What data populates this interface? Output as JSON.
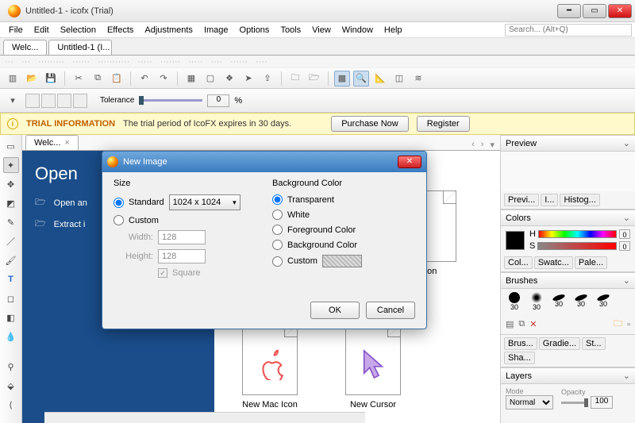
{
  "titlebar": {
    "title": "Untitled-1 - icofx (Trial)"
  },
  "menu": [
    "File",
    "Edit",
    "Selection",
    "Effects",
    "Adjustments",
    "Image",
    "Options",
    "Tools",
    "View",
    "Window",
    "Help"
  ],
  "search_placeholder": "Search... (Alt+Q)",
  "doctabs": [
    "Welc...",
    "Untitled-1 (I..."
  ],
  "tolerance": {
    "label": "Tolerance",
    "value": "0",
    "unit": "%"
  },
  "trial": {
    "title": "TRIAL INFORMATION",
    "text": "The trial period of IcoFX expires in 30 days.",
    "purchase": "Purchase Now",
    "register": "Register"
  },
  "canvas_tab": "Welc...",
  "bluepane": {
    "heading": "Open",
    "row1": "Open an",
    "row2": "Extract i"
  },
  "whitepane": {
    "item_icon": "Icon",
    "item_mac": "New Mac Icon",
    "item_cursor": "New Cursor"
  },
  "right": {
    "preview": "Preview",
    "preview_tabs": [
      "Previ...",
      "I...",
      "Histog..."
    ],
    "colors": "Colors",
    "h_label": "H",
    "s_label": "S",
    "h_val": "0",
    "s_val": "0",
    "colors_tabs": [
      "Col...",
      "Swatc...",
      "Pale..."
    ],
    "brushes": "Brushes",
    "brush_size": "30",
    "brushes_tabs": [
      "Brus...",
      "Gradie...",
      "St...",
      "Sha..."
    ],
    "layers": "Layers",
    "mode_label": "Mode",
    "opacity_label": "Opacity",
    "mode_value": "Normal",
    "opacity_value": "100"
  },
  "dialog": {
    "title": "New Image",
    "size": "Size",
    "standard": "Standard",
    "custom": "Custom",
    "size_value": "1024 x 1024",
    "width_lbl": "Width:",
    "width_val": "128",
    "height_lbl": "Height:",
    "height_val": "128",
    "square": "Square",
    "bg": "Background Color",
    "transparent": "Transparent",
    "white": "White",
    "fg": "Foreground Color",
    "bgc": "Background Color",
    "custom_bg": "Custom",
    "ok": "OK",
    "cancel": "Cancel"
  }
}
